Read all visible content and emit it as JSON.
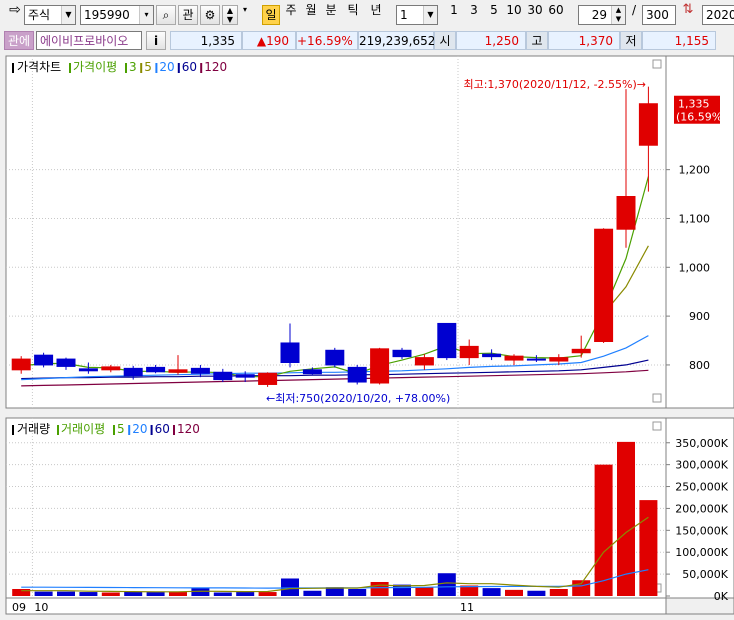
{
  "toolbar": {
    "market_type": "주식",
    "code": "195990",
    "btn_watch": "관",
    "period_labels": [
      "일",
      "주",
      "월",
      "분",
      "틱",
      "년"
    ],
    "active_period": "일",
    "interval_value": "1",
    "quick_intervals": [
      "1",
      "3",
      "5",
      "10",
      "30",
      "60"
    ],
    "count_value": "29",
    "slash": "/",
    "total_value": "300",
    "date_field": "2020/"
  },
  "quote": {
    "tag": "관에",
    "stock_name": "에이비프로바이오",
    "info_btn": "i",
    "price": "1,335",
    "change": "▲190",
    "change_pct": "+16.59%",
    "volume": "219,239,652",
    "open_label": "시",
    "open": "1,250",
    "high_label": "고",
    "high": "1,370",
    "low_label": "저",
    "low": "1,155"
  },
  "colors": {
    "up": "#e00000",
    "down": "#0000d0",
    "ma3": "#4aa000",
    "ma5": "#8a8a00",
    "ma20": "#2080ff",
    "ma60": "#000090",
    "ma120": "#800040",
    "grid": "#c8c8c8",
    "price_tag_bg": "#e00000"
  },
  "chart_data": [
    {
      "type": "candlestick",
      "title": "가격차트",
      "legend": [
        {
          "label": "가격이평",
          "color": "#4aa000"
        },
        {
          "label": "3",
          "color": "#4aa000"
        },
        {
          "label": "5",
          "color": "#8a8a00"
        },
        {
          "label": "20",
          "color": "#2080ff"
        },
        {
          "label": "60",
          "color": "#000090"
        },
        {
          "label": "120",
          "color": "#800040"
        }
      ],
      "yticks": [
        800,
        900,
        1000,
        1100,
        1200
      ],
      "ylim": [
        720,
        1400
      ],
      "current_price_label": "1,335",
      "current_pct_label": "(16.59%)",
      "annotation_high": "최고:1,370(2020/11/12, -2.55%)→",
      "annotation_low": "←최저:750(2020/10/20, +78.00%)",
      "candles": [
        {
          "o": 790,
          "h": 818,
          "l": 782,
          "c": 812
        },
        {
          "o": 820,
          "h": 825,
          "l": 795,
          "c": 800
        },
        {
          "o": 812,
          "h": 815,
          "l": 790,
          "c": 797
        },
        {
          "o": 792,
          "h": 805,
          "l": 782,
          "c": 788
        },
        {
          "o": 790,
          "h": 800,
          "l": 785,
          "c": 796
        },
        {
          "o": 793,
          "h": 798,
          "l": 770,
          "c": 778
        },
        {
          "o": 795,
          "h": 800,
          "l": 783,
          "c": 786
        },
        {
          "o": 785,
          "h": 820,
          "l": 780,
          "c": 790
        },
        {
          "o": 793,
          "h": 800,
          "l": 775,
          "c": 783
        },
        {
          "o": 785,
          "h": 792,
          "l": 765,
          "c": 770
        },
        {
          "o": 780,
          "h": 787,
          "l": 765,
          "c": 775
        },
        {
          "o": 760,
          "h": 785,
          "l": 755,
          "c": 783
        },
        {
          "o": 845,
          "h": 885,
          "l": 795,
          "c": 805
        },
        {
          "o": 790,
          "h": 795,
          "l": 780,
          "c": 782
        },
        {
          "o": 830,
          "h": 835,
          "l": 795,
          "c": 800
        },
        {
          "o": 795,
          "h": 800,
          "l": 760,
          "c": 765
        },
        {
          "o": 763,
          "h": 835,
          "l": 760,
          "c": 833
        },
        {
          "o": 830,
          "h": 835,
          "l": 812,
          "c": 817
        },
        {
          "o": 800,
          "h": 822,
          "l": 790,
          "c": 815
        },
        {
          "o": 885,
          "h": 885,
          "l": 810,
          "c": 815
        },
        {
          "o": 815,
          "h": 852,
          "l": 800,
          "c": 838
        },
        {
          "o": 822,
          "h": 832,
          "l": 810,
          "c": 817
        },
        {
          "o": 810,
          "h": 822,
          "l": 800,
          "c": 818
        },
        {
          "o": 812,
          "h": 820,
          "l": 806,
          "c": 810
        },
        {
          "o": 808,
          "h": 822,
          "l": 800,
          "c": 815
        },
        {
          "o": 825,
          "h": 860,
          "l": 815,
          "c": 832
        },
        {
          "o": 848,
          "h": 1080,
          "l": 845,
          "c": 1078
        },
        {
          "o": 1078,
          "h": 1365,
          "l": 1040,
          "c": 1145
        },
        {
          "o": 1250,
          "h": 1370,
          "l": 1155,
          "c": 1335
        }
      ],
      "ma_series": {
        "ma3": [
          798,
          803,
          803,
          795,
          794,
          787,
          787,
          785,
          786,
          784,
          776,
          776,
          787,
          792,
          796,
          782,
          799,
          810,
          822,
          839,
          823,
          824,
          817,
          815,
          814,
          819,
          909,
          1018,
          1186
        ],
        "ma20": [
          770,
          772,
          774,
          776,
          777,
          778,
          779,
          780,
          781,
          782,
          783,
          783,
          784,
          785,
          785,
          786,
          787,
          788,
          790,
          792,
          795,
          797,
          798,
          800,
          802,
          805,
          818,
          835,
          860
        ],
        "ma60": [
          772,
          773,
          774,
          774,
          775,
          775,
          776,
          776,
          777,
          777,
          778,
          778,
          778,
          779,
          779,
          780,
          780,
          781,
          782,
          783,
          784,
          785,
          786,
          787,
          788,
          790,
          795,
          800,
          810
        ],
        "ma120": [
          757,
          758,
          759,
          760,
          761,
          762,
          763,
          764,
          765,
          766,
          767,
          768,
          769,
          770,
          771,
          772,
          773,
          774,
          775,
          776,
          777,
          778,
          779,
          780,
          781,
          782,
          784,
          786,
          789
        ],
        "ma5_tail": [
          905,
          960,
          1044
        ]
      }
    },
    {
      "type": "bar",
      "title": "거래량",
      "legend": [
        {
          "label": "거래이평",
          "color": "#4aa000"
        },
        {
          "label": "5",
          "color": "#4aa000"
        },
        {
          "label": "20",
          "color": "#2080ff"
        },
        {
          "label": "60",
          "color": "#000090"
        },
        {
          "label": "120",
          "color": "#800040"
        }
      ],
      "yticks": [
        0,
        50000,
        100000,
        150000,
        200000,
        250000,
        300000,
        350000
      ],
      "ytick_labels": [
        "0K",
        "50,000K",
        "100,000K",
        "150,000K",
        "200,000K",
        "250,000K",
        "300,000K",
        "350,000K"
      ],
      "ylim": [
        0,
        370000
      ],
      "volumes": [
        16000,
        10000,
        10000,
        9000,
        8000,
        10000,
        9000,
        9000,
        18000,
        8000,
        9000,
        9000,
        40000,
        12000,
        20000,
        16000,
        32000,
        26000,
        20000,
        52000,
        24000,
        18000,
        14000,
        12000,
        16000,
        36000,
        300000,
        352000,
        219000
      ],
      "ma5_vol": [
        12000,
        12000,
        12000,
        11000,
        10500,
        10000,
        9500,
        9500,
        11000,
        10500,
        10000,
        10200,
        17000,
        17500,
        18200,
        18000,
        25000,
        23000,
        24000,
        30000,
        28000,
        28000,
        25000,
        22000,
        20000,
        28000,
        100000,
        145000,
        180000
      ],
      "ma20_vol": [
        20000,
        20000,
        19800,
        19600,
        19400,
        19200,
        19000,
        18800,
        18600,
        18400,
        18200,
        18000,
        18200,
        18300,
        18400,
        18500,
        19000,
        19400,
        19800,
        21000,
        21500,
        21800,
        22000,
        22000,
        22000,
        23000,
        35000,
        50000,
        60000
      ],
      "x_labels": [
        {
          "index": 0,
          "text": "09"
        },
        {
          "index": 1,
          "text": "10"
        },
        {
          "index": 20,
          "text": "11"
        }
      ]
    }
  ]
}
